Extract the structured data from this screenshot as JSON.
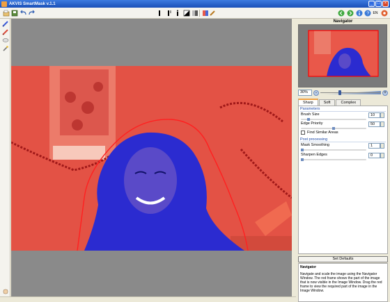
{
  "window": {
    "title": "AKVIS SmartMask v.1.1"
  },
  "toolbar": {
    "lang": "EN",
    "icons": [
      "open-icon",
      "save-icon",
      "undo-icon",
      "redo-icon",
      "cursor-icon",
      "brush-icon",
      "eraser-icon",
      "pipette-icon",
      "magic-brush-icon",
      "back-icon",
      "forward-icon",
      "info-icon",
      "help-icon",
      "settings-icon"
    ]
  },
  "tools": [
    "blue-pencil-tool",
    "red-pencil-tool",
    "eraser-tool",
    "magic-tube-tool"
  ],
  "navigator": {
    "title": "Navigator",
    "zoom": "30%"
  },
  "tabs": [
    {
      "label": "Sharp",
      "active": true
    },
    {
      "label": "Soft",
      "active": false
    },
    {
      "label": "Complex",
      "active": false
    }
  ],
  "params": {
    "section": "Parameters",
    "brush_size_label": "Brush Size",
    "brush_size_value": "10",
    "brush_size_level": 0.1,
    "edge_priority_label": "Edge Priority",
    "edge_priority_value": "50",
    "edge_priority_level": 0.5,
    "find_similar_label": "Find Similar Areas"
  },
  "post": {
    "section": "Post processing",
    "mask_smoothing_label": "Mask Smoothing",
    "mask_smoothing_value": "1",
    "sharpen_edges_label": "Sharpen Edges",
    "sharpen_edges_value": "0"
  },
  "buttons": {
    "set_defaults": "Set Defaults"
  },
  "help": {
    "title": "Navigator",
    "text": "Navigate and scale the image using the Navigator Window. The red frame shows the part of the image that is now visible in the Image Window. Drag the red frame to view the required part of the image in the Image Window."
  },
  "colors": {
    "accent": "#f0a040",
    "mask_red": "#e8433a",
    "mask_blue": "#2a2ad8"
  }
}
